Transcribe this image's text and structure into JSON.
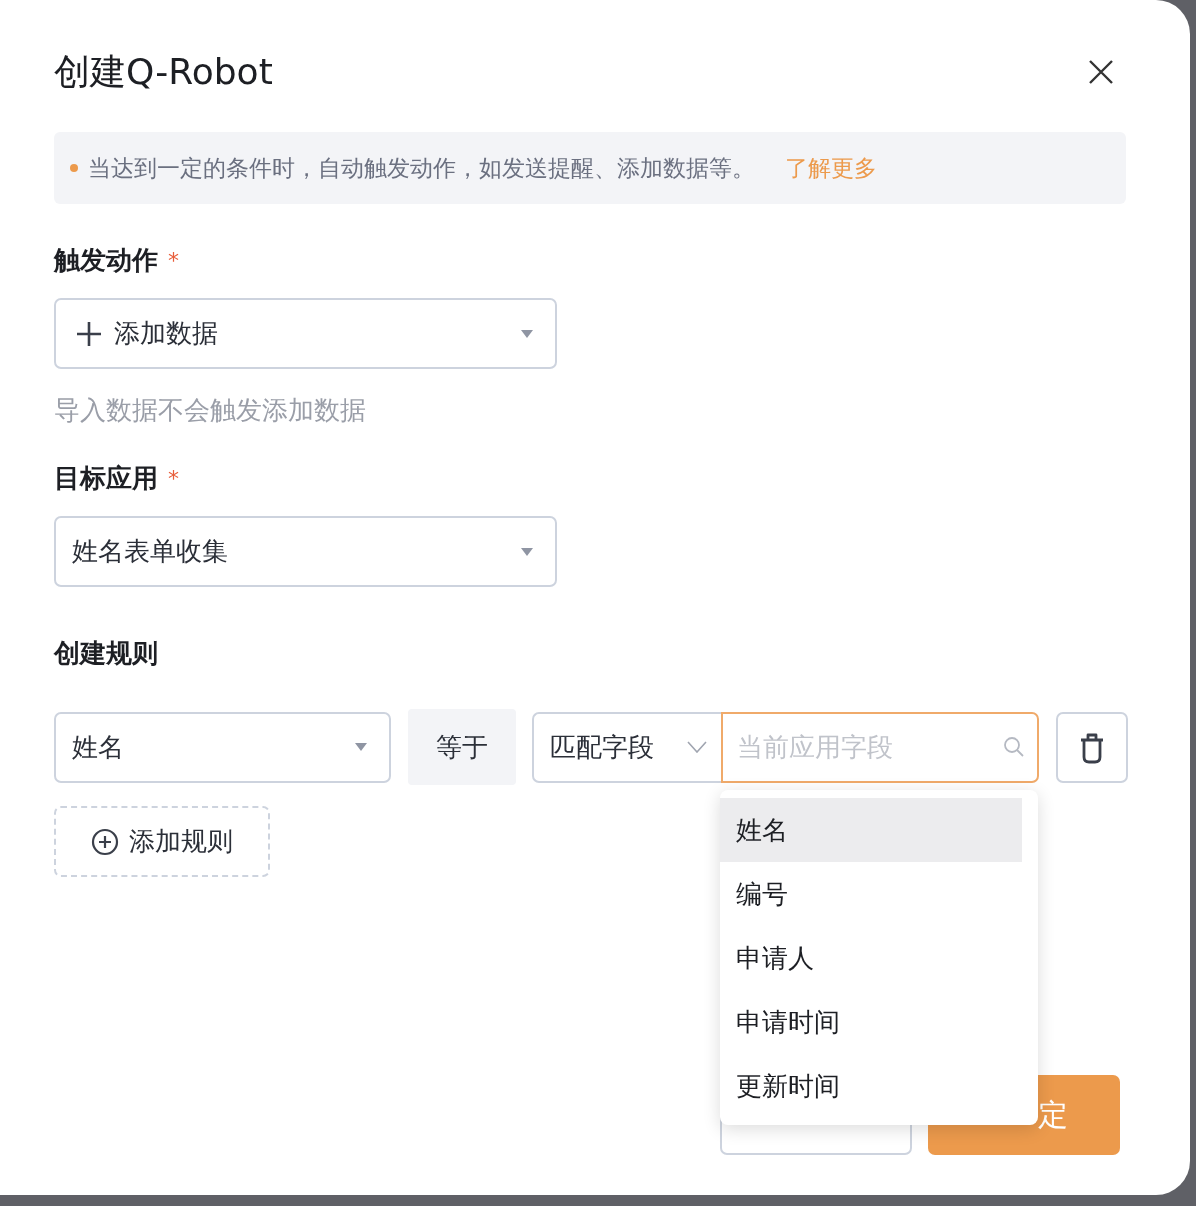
{
  "dialog": {
    "title": "创建Q-Robot"
  },
  "notice": {
    "text": "当达到一定的条件时，自动触发动作，如发送提醒、添加数据等。",
    "link": "了解更多"
  },
  "trigger_action": {
    "label": "触发动作",
    "required_mark": "*",
    "value": "添加数据",
    "hint": "导入数据不会触发添加数据"
  },
  "target_app": {
    "label": "目标应用",
    "required_mark": "*",
    "value": "姓名表单收集"
  },
  "rules": {
    "label": "创建规则",
    "items": [
      {
        "field": "姓名",
        "operator": "等于",
        "match_type": "匹配字段",
        "search_placeholder": "当前应用字段",
        "focused": true
      }
    ],
    "add_button": "添加规则"
  },
  "dropdown": {
    "options": [
      {
        "label": "姓名",
        "selected": true
      },
      {
        "label": "编号",
        "selected": false
      },
      {
        "label": "申请人",
        "selected": false
      },
      {
        "label": "申请时间",
        "selected": false
      },
      {
        "label": "更新时间",
        "selected": false
      }
    ]
  },
  "footer": {
    "buttons": [
      {
        "kind": "secondary"
      },
      {
        "kind": "primary",
        "label": "定"
      }
    ]
  }
}
